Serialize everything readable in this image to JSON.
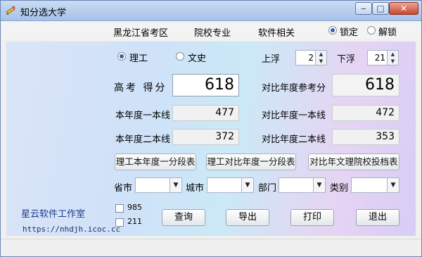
{
  "window": {
    "title": "知分选大学"
  },
  "menu": {
    "items": [
      "黑龙江省考区",
      "院校专业",
      "软件相关"
    ],
    "lock_label": "锁定",
    "unlock_label": "解锁"
  },
  "stream": {
    "science": "理工",
    "liberal": "文史"
  },
  "float": {
    "up_label": "上浮",
    "up_value": "2",
    "down_label": "下浮",
    "down_value": "21"
  },
  "score": {
    "label": "高考 得分",
    "value": "618",
    "ref_label": "对比年度参考分",
    "ref_value": "618"
  },
  "lines": {
    "cur_first_label": "本年度一本线",
    "cur_first_value": "477",
    "cmp_first_label": "对比年度一本线",
    "cmp_first_value": "472",
    "cur_second_label": "本年度二本线",
    "cur_second_value": "372",
    "cmp_second_label": "对比年度二本线",
    "cmp_second_value": "353"
  },
  "tables": {
    "btn1": "理工本年度一分段表",
    "btn2": "理工对比年度一分段表",
    "btn3": "对比年文理院校投档表"
  },
  "filters": {
    "province": "省市",
    "city": "城市",
    "dept": "部门",
    "category": "类别"
  },
  "checks": {
    "c985": "985",
    "c211": "211"
  },
  "actions": {
    "query": "查询",
    "export": "导出",
    "print": "打印",
    "exit": "退出"
  },
  "footer": {
    "studio": "星云软件工作室",
    "url": "https://nhdjh.icoc.cc"
  }
}
